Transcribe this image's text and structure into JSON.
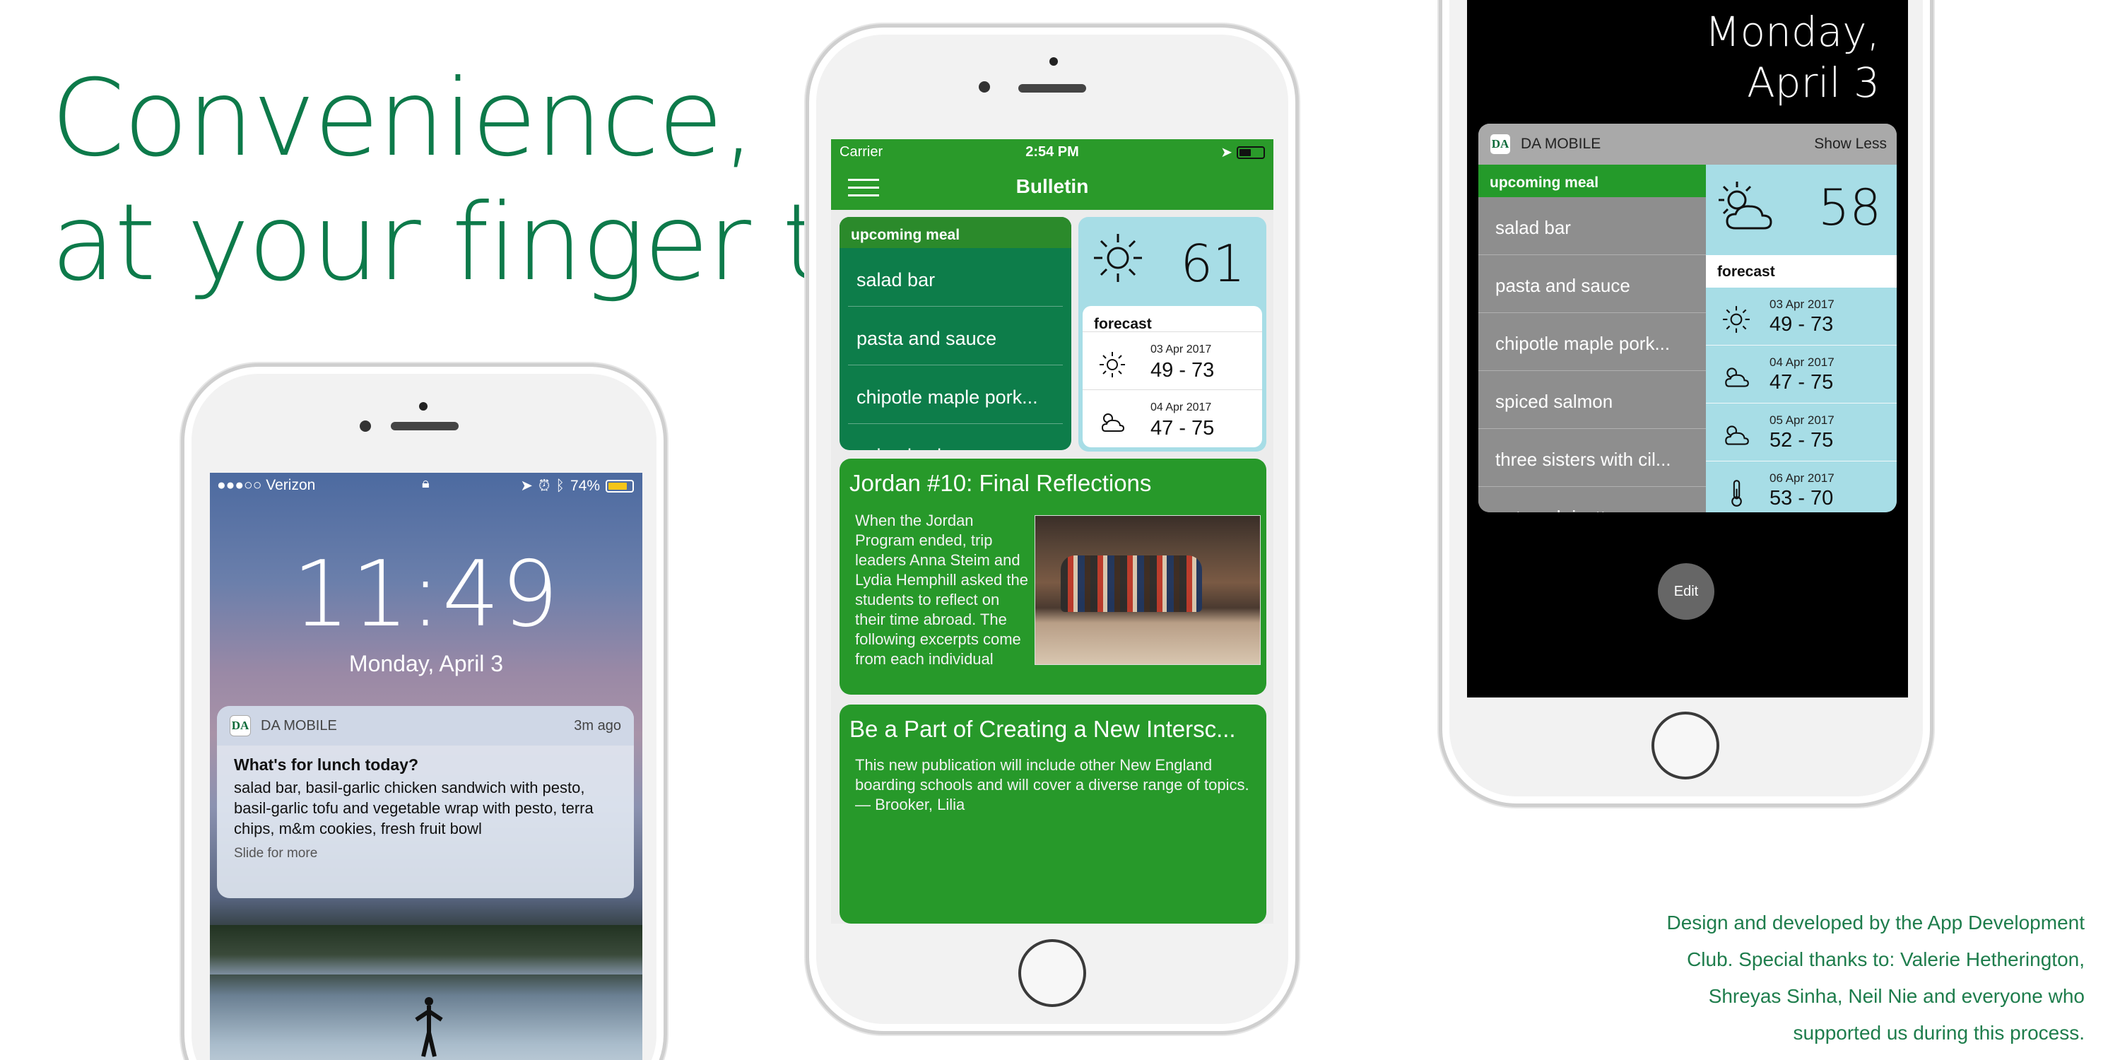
{
  "headline": {
    "line1": "Convenience,",
    "line2": "at your finger tip"
  },
  "credits": {
    "line1": "Design and developed by the App Development",
    "line2": "Club. Special thanks to: Valerie Hetherington,",
    "line3": "Shreyas Sinha, Neil Nie and everyone who",
    "line4": "supported us during this process."
  },
  "colors": {
    "brand_green": "#0d7a4a",
    "app_green": "#2a9a2a",
    "meal_green": "#0d7d4a",
    "weather_blue": "#a7dde6"
  },
  "lock_screen": {
    "carrier": "●●●○○ Verizon",
    "battery": "74%",
    "battery_level": 0.74,
    "time": "11:49",
    "date": "Monday, April 3",
    "notification": {
      "app_icon": "DA",
      "app_name": "DA MOBILE",
      "age": "3m ago",
      "title": "What's for lunch today?",
      "body": "salad bar, basil-garlic chicken sandwich with pesto, basil-garlic tofu and vegetable wrap with pesto, terra chips, m&m cookies, fresh fruit bowl",
      "more": "Slide for more"
    }
  },
  "bulletin_app": {
    "status": {
      "carrier": "Carrier",
      "time": "2:54 PM"
    },
    "nav_title": "Bulletin",
    "meal": {
      "header": "upcoming meal",
      "items": [
        "salad bar",
        "pasta and sauce",
        "chipotle maple pork...",
        "spiced salmon"
      ]
    },
    "weather": {
      "current_temp": "61",
      "current_icon": "sun-icon",
      "forecast_label": "forecast",
      "forecast": [
        {
          "date": "03 Apr 2017",
          "range": "49 - 73",
          "icon": "sun-icon"
        },
        {
          "date": "04 Apr 2017",
          "range": "47 - 75",
          "icon": "partly-cloudy-icon"
        }
      ]
    },
    "articles": [
      {
        "title": "Jordan #10: Final Reflections",
        "body": "When the Jordan Program ended, trip leaders Anna Steim and Lydia Hemphill asked the students to reflect on their time abroad. The following excerpts come from each individual"
      },
      {
        "title": "Be a Part of Creating a New Intersc...",
        "body": "This new publication will include other New England boarding schools and will cover a diverse range of topics. — Brooker, Lilia"
      }
    ]
  },
  "widget_screen": {
    "date_line1": "Monday,",
    "date_line2": "April 3",
    "widget": {
      "app_icon": "DA",
      "app_name": "DA MOBILE",
      "toggle": "Show Less",
      "meal_header": "upcoming meal",
      "meal_items": [
        "salad bar",
        "pasta and sauce",
        "chipotle maple pork...",
        "spiced salmon",
        "three sisters with cil...",
        "oatmeal risotto"
      ],
      "current_temp": "58",
      "current_icon": "partly-cloudy-icon",
      "forecast_label": "forecast",
      "forecast": [
        {
          "date": "03 Apr 2017",
          "range": "49 - 73",
          "icon": "sun-icon"
        },
        {
          "date": "04 Apr 2017",
          "range": "47 - 75",
          "icon": "partly-cloudy-icon"
        },
        {
          "date": "05 Apr 2017",
          "range": "52 - 75",
          "icon": "partly-cloudy-icon"
        },
        {
          "date": "06 Apr 2017",
          "range": "53 - 70",
          "icon": "thermometer-icon"
        }
      ]
    },
    "edit_label": "Edit"
  }
}
